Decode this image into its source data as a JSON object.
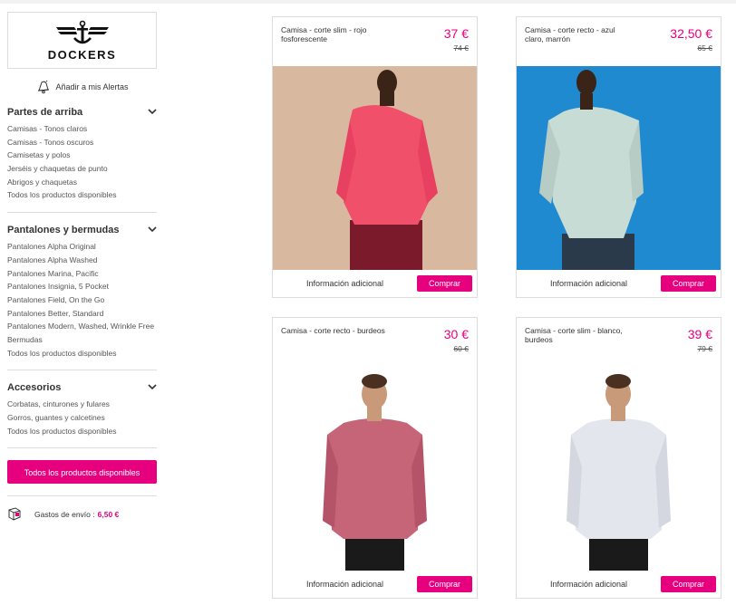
{
  "brand": {
    "name": "DOCKERS"
  },
  "alert": {
    "label": "Añadir a mis Alertas"
  },
  "sections": [
    {
      "title": "Partes de arriba",
      "items": [
        "Camisas - Tonos claros",
        "Camisas - Tonos oscuros",
        "Camisetas y polos",
        "Jerséis y chaquetas de punto",
        "Abrigos y chaquetas",
        "Todos los productos disponibles"
      ]
    },
    {
      "title": "Pantalones y bermudas",
      "items": [
        "Pantalones Alpha Original",
        "Pantalones Alpha Washed",
        "Pantalones Marina, Pacific",
        "Pantalones Insignia, 5 Pocket",
        "Pantalones Field, On the Go",
        "Pantalones Better, Standard",
        "Pantalones Modern, Washed, Wrinkle Free",
        "Bermudas",
        "Todos los productos disponibles"
      ]
    },
    {
      "title": "Accesorios",
      "items": [
        "Corbatas, cinturones y fulares",
        "Gorros, guantes y calcetines",
        "Todos los productos disponibles"
      ]
    }
  ],
  "all_products_button": "Todos los productos disponibles",
  "shipping": {
    "label": "Gastos de envío :",
    "price": "6,50 €"
  },
  "products": [
    {
      "name": "Camisa - corte slim - rojo fosforescente",
      "price": "37 €",
      "old_price": "74 €",
      "info": "Información adicional",
      "buy": "Comprar",
      "shirt_color": "#f0506a",
      "bg_color": "#d9b8a0",
      "pants_color": "#7a1a2a"
    },
    {
      "name": "Camisa - corte recto - azul claro, marrón",
      "price": "32,50 €",
      "old_price": "65 €",
      "info": "Información adicional",
      "buy": "Comprar",
      "shirt_color": "#c8dcd6",
      "bg_color": "#1f8ad0",
      "pants_color": "#2a3a4a"
    },
    {
      "name": "Camisa - corte recto - burdeos",
      "price": "30 €",
      "old_price": "60 €",
      "info": "Información adicional",
      "buy": "Comprar",
      "shirt_color": "#c66478",
      "bg_color": "#ffffff",
      "pants_color": "#1a1a1a"
    },
    {
      "name": "Camisa - corte slim - blanco, burdeos",
      "price": "39 €",
      "old_price": "79 €",
      "info": "Información adicional",
      "buy": "Comprar",
      "shirt_color": "#e4e6ee",
      "bg_color": "#ffffff",
      "pants_color": "#1a1a1a"
    }
  ]
}
